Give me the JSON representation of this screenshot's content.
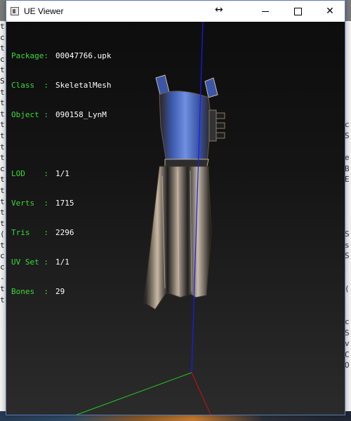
{
  "window": {
    "title": "UE Viewer",
    "minimize_symbol": "—",
    "maximize_symbol": "☐",
    "close_symbol": "✕",
    "resize_cursor": "↔"
  },
  "info": {
    "package_label": "Package:",
    "package_value": "00047766.upk",
    "class_label": "Class  :",
    "class_value": "SkeletalMesh",
    "object_label": "Object :",
    "object_value": "090158_LynM",
    "lod_label": "LOD    :",
    "lod_value": "1/1",
    "verts_label": "Verts  :",
    "verts_value": "1715",
    "tris_label": "Tris   :",
    "tris_value": "2296",
    "uvset_label": "UV Set :",
    "uvset_value": "1/1",
    "bones_label": "Bones  :",
    "bones_value": "29"
  },
  "colors": {
    "label_green": "#39d93a",
    "value_white": "#ffffff",
    "axis_x": "#cc1111",
    "axis_y": "#22cc22",
    "axis_z": "#1a1aff",
    "viewport_bg": "#151515"
  },
  "background_console": {
    "left_chars": [
      "t",
      "c",
      "t",
      "c",
      "t",
      "S",
      "t",
      "t",
      "t",
      "t",
      "t",
      "t",
      "t",
      "c",
      "t",
      "t",
      "t",
      "t",
      "t",
      "(",
      "t",
      "c",
      "c",
      "-",
      "t",
      "t"
    ],
    "right_chars": [
      "",
      "",
      "",
      "",
      "",
      "",
      "",
      "",
      "",
      "c",
      "S",
      "",
      "e",
      "B",
      "E",
      "",
      "",
      "",
      "",
      "S",
      "s",
      "S",
      "",
      "",
      "(",
      "",
      "",
      "c",
      "S",
      "v",
      "C",
      "O",
      "",
      "",
      "",
      ""
    ]
  },
  "model": {
    "name": "mesh-model",
    "description_icon": "skeletal-mesh-render"
  }
}
